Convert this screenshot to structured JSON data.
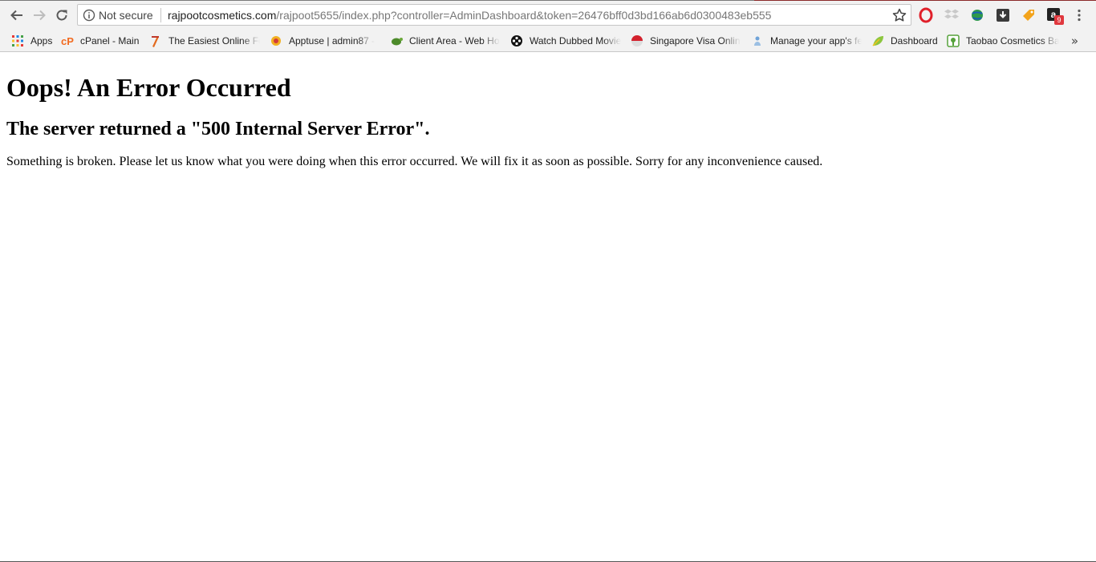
{
  "browser": {
    "security_label": "Not secure",
    "url_host": "rajpootcosmetics.com",
    "url_path": "/rajpoot5655/index.php?controller=AdminDashboard&token=26476bff0d3bd166ab6d0300483eb555",
    "extensions": [
      {
        "name": "opera-icon"
      },
      {
        "name": "dropbox-icon"
      },
      {
        "name": "globe-extension-icon"
      },
      {
        "name": "download-extension-icon"
      },
      {
        "name": "tag-extension-icon"
      },
      {
        "name": "amazon-extension-icon",
        "badge": "9"
      }
    ]
  },
  "bookmarks": [
    {
      "label": "Apps",
      "icon": "apps-grid-icon"
    },
    {
      "label": "cPanel - Main",
      "icon": "cpanel-icon"
    },
    {
      "label": "The Easiest Online Fo",
      "icon": "form-pen-icon"
    },
    {
      "label": "Apptuse | admin87 -",
      "icon": "apptuse-icon"
    },
    {
      "label": "Client Area - Web Ho",
      "icon": "turtle-icon"
    },
    {
      "label": "Watch Dubbed Movie",
      "icon": "film-reel-icon"
    },
    {
      "label": "Singapore Visa Onlin",
      "icon": "singapore-flag-icon"
    },
    {
      "label": "Manage your app's fe",
      "icon": "person-icon"
    },
    {
      "label": "Dashboard",
      "icon": "leaf-icon"
    },
    {
      "label": "Taobao Cosmetics Ba",
      "icon": "taobao-icon"
    }
  ],
  "page": {
    "title": "Oops! An Error Occurred",
    "subtitle": "The server returned a \"500 Internal Server Error\".",
    "message": "Something is broken. Please let us know what you were doing when this error occurred. We will fix it as soon as possible. Sorry for any inconvenience caused."
  },
  "colors": {
    "toolbar_bg": "#f2f2f2",
    "opera_red": "#e0202a",
    "badge_red": "#e0383e"
  }
}
